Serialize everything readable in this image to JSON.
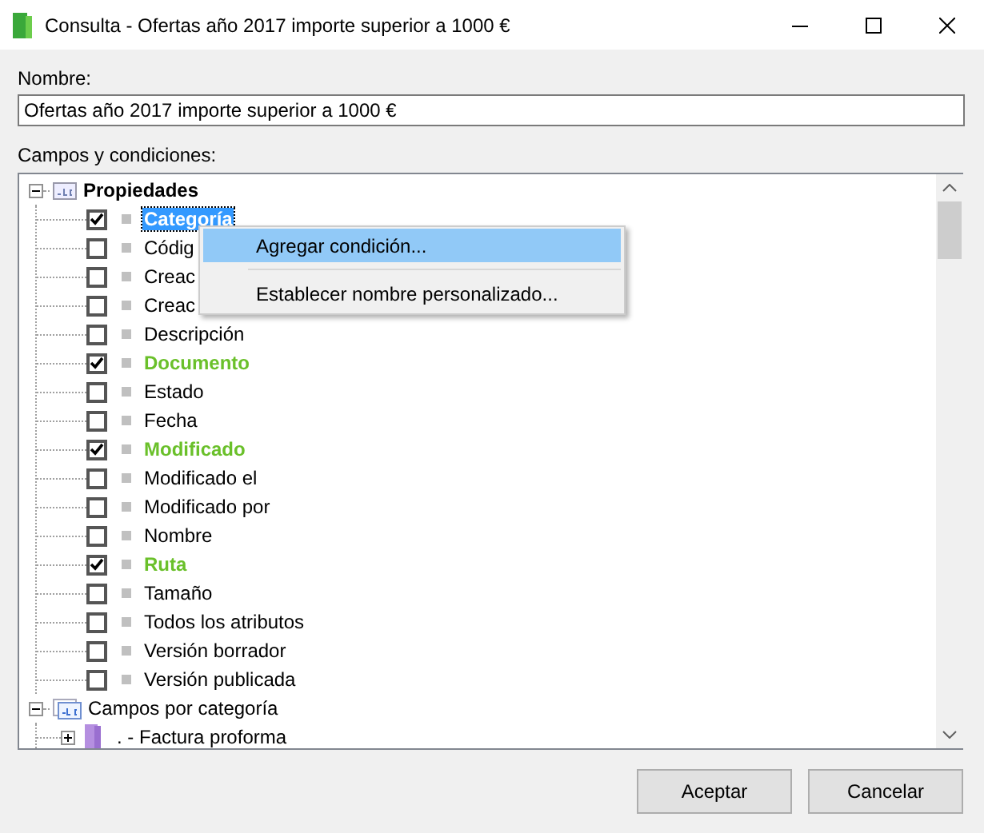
{
  "window": {
    "title": "Consulta - Ofertas año 2017 importe superior a 1000 €"
  },
  "name_field": {
    "label": "Nombre:",
    "value": "Ofertas año 2017 importe superior a 1000 €"
  },
  "tree_label": "Campos y condiciones:",
  "tree": [
    {
      "label": "Propiedades",
      "kind": "properties",
      "expanded": true,
      "children": [
        {
          "label": "Categoría",
          "checked": true,
          "selected": true
        },
        {
          "label": "Códig",
          "checked": false,
          "selected": false
        },
        {
          "label": "Creac",
          "checked": false,
          "selected": false
        },
        {
          "label": "Creac",
          "checked": false,
          "selected": false
        },
        {
          "label": "Descripción",
          "checked": false,
          "selected": false
        },
        {
          "label": "Documento",
          "checked": true,
          "selected": false
        },
        {
          "label": "Estado",
          "checked": false,
          "selected": false
        },
        {
          "label": "Fecha",
          "checked": false,
          "selected": false
        },
        {
          "label": "Modificado",
          "checked": true,
          "selected": false
        },
        {
          "label": "Modificado el",
          "checked": false,
          "selected": false
        },
        {
          "label": "Modificado por",
          "checked": false,
          "selected": false
        },
        {
          "label": "Nombre",
          "checked": false,
          "selected": false
        },
        {
          "label": "Ruta",
          "checked": true,
          "selected": false
        },
        {
          "label": "Tamaño",
          "checked": false,
          "selected": false
        },
        {
          "label": "Todos los atributos",
          "checked": false,
          "selected": false
        },
        {
          "label": "Versión borrador",
          "checked": false,
          "selected": false
        },
        {
          "label": "Versión publicada",
          "checked": false,
          "selected": false
        }
      ]
    },
    {
      "label": "Campos por categoría",
      "kind": "categories",
      "expanded": true,
      "children": [
        {
          "label": ". - Factura proforma",
          "expanded": false
        }
      ]
    }
  ],
  "context_menu": [
    {
      "label": "Agregar condición...",
      "selected": true
    },
    {
      "label": "Establecer nombre personalizado...",
      "selected": false
    }
  ],
  "buttons": [
    "Aceptar",
    "Cancelar"
  ]
}
